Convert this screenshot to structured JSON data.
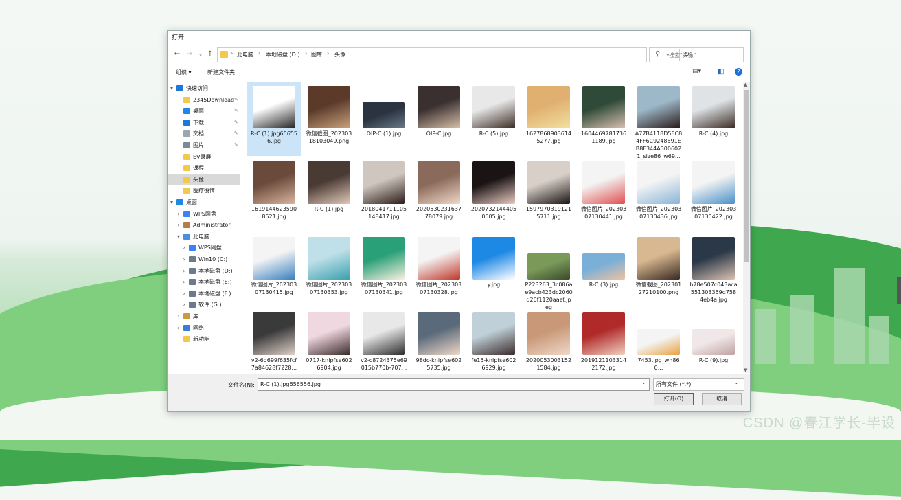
{
  "dialog": {
    "title": "打开",
    "address": {
      "crumbs": [
        "此电脑",
        "本地磁盘 (D:)",
        "图库",
        "头像"
      ],
      "search_placeholder": "搜索\"头像\""
    },
    "toolbar": {
      "organize": "组织 ▾",
      "new_folder": "新建文件夹"
    },
    "nav": [
      {
        "label": "快速访问",
        "level": 0,
        "icon": "star-icon",
        "color": "#1e78d7",
        "arrow": "▾"
      },
      {
        "label": "2345Download",
        "level": 1,
        "icon": "folder-icon",
        "color": "#f3c94b",
        "pin": true
      },
      {
        "label": "桌面",
        "level": 1,
        "icon": "desktop-icon",
        "color": "#1e88e5",
        "pin": true
      },
      {
        "label": "下载",
        "level": 1,
        "icon": "download-icon",
        "color": "#1e78d7",
        "pin": true
      },
      {
        "label": "文档",
        "level": 1,
        "icon": "document-icon",
        "color": "#9aa6b2",
        "pin": true
      },
      {
        "label": "图片",
        "level": 1,
        "icon": "pictures-icon",
        "color": "#7a8a9a",
        "pin": true
      },
      {
        "label": "EV录屏",
        "level": 1,
        "icon": "folder-icon",
        "color": "#f3c94b"
      },
      {
        "label": "课程",
        "level": 1,
        "icon": "folder-icon",
        "color": "#f3c94b"
      },
      {
        "label": "头像",
        "level": 1,
        "icon": "folder-icon",
        "color": "#f3c94b",
        "selected": true
      },
      {
        "label": "医疗役情",
        "level": 1,
        "icon": "folder-icon",
        "color": "#f3c94b"
      },
      {
        "label": "桌面",
        "level": 0,
        "icon": "desktop-icon",
        "color": "#1e88e5",
        "arrow": "▾"
      },
      {
        "label": "WPS网盘",
        "level": 1,
        "icon": "cloud-icon",
        "color": "#3b82f6",
        "arrow": "›"
      },
      {
        "label": "Administrator",
        "level": 1,
        "icon": "user-icon",
        "color": "#b77b4a",
        "arrow": "›"
      },
      {
        "label": "此电脑",
        "level": 1,
        "icon": "computer-icon",
        "color": "#4a90e2",
        "arrow": "▾"
      },
      {
        "label": "WPS网盘",
        "level": 2,
        "icon": "cloud-icon",
        "color": "#3b82f6",
        "arrow": "›"
      },
      {
        "label": "Win10 (C:)",
        "level": 2,
        "icon": "drive-icon",
        "color": "#6b7b8b",
        "arrow": "›"
      },
      {
        "label": "本地磁盘 (D:)",
        "level": 2,
        "icon": "drive-icon",
        "color": "#6b7b8b",
        "arrow": "›"
      },
      {
        "label": "本地磁盘 (E:)",
        "level": 2,
        "icon": "drive-icon",
        "color": "#6b7b8b",
        "arrow": "›"
      },
      {
        "label": "本地磁盘 (F:)",
        "level": 2,
        "icon": "drive-icon",
        "color": "#6b7b8b",
        "arrow": "›"
      },
      {
        "label": "软件 (G:)",
        "level": 2,
        "icon": "drive-icon",
        "color": "#6b7b8b",
        "arrow": "›"
      },
      {
        "label": "库",
        "level": 1,
        "icon": "library-icon",
        "color": "#c89b3c",
        "arrow": "›"
      },
      {
        "label": "网络",
        "level": 1,
        "icon": "network-icon",
        "color": "#3b7dd8",
        "arrow": "›"
      },
      {
        "label": "新功能",
        "level": 1,
        "icon": "folder-icon",
        "color": "#f3c94b"
      }
    ],
    "files": [
      {
        "name": "R-C (1).jpg656556.jpg",
        "thumb": "#ffffff",
        "accent": "#222",
        "selected": true
      },
      {
        "name": "微信截图_20230318103049.png",
        "thumb": "#5b3a2a",
        "accent": "#c9a27b"
      },
      {
        "name": "OIP-C (1).jpg",
        "thumb": "#2b3340",
        "accent": "#6a7a88",
        "wide": true
      },
      {
        "name": "OIP-C.jpg",
        "thumb": "#3a3030",
        "accent": "#d8c0a8"
      },
      {
        "name": "R-C (5).jpg",
        "thumb": "#e8e8e8",
        "accent": "#3a2a22"
      },
      {
        "name": "16278689036145277.jpg",
        "thumb": "#e0b070",
        "accent": "#f3e0a0"
      },
      {
        "name": "16044697817361189.jpg",
        "thumb": "#2f4a38",
        "accent": "#d8c0b0"
      },
      {
        "name": "A77B4118D5EC84FF6C9248591EB8F344A3006021_size86_w69...",
        "thumb": "#9db8c8",
        "accent": "#2a1a18"
      },
      {
        "name": "R-C (4).jpg",
        "thumb": "#dfe3e6",
        "accent": "#3a2a22"
      },
      {
        "name": "16191446235908521.jpg",
        "thumb": "#6a4a3a",
        "accent": "#d9b4a0"
      },
      {
        "name": "R-C (1).jpg",
        "thumb": "#4a3a34",
        "accent": "#e0c8b8"
      },
      {
        "name": "2018041711105148417.jpg",
        "thumb": "#cfc6bf",
        "accent": "#2a1a18"
      },
      {
        "name": "2020530231637 78079.jpg",
        "thumb": "#8a6a5a",
        "accent": "#f0d8c8"
      },
      {
        "name": "20207321444050505.jpg",
        "thumb": "#1a1414",
        "accent": "#e8c8c0"
      },
      {
        "name": "15979703191215711.jpg",
        "thumb": "#d8d0c8",
        "accent": "#1a1414"
      },
      {
        "name": "微信图片_20230307130441.jpg",
        "thumb": "#f4f4f4",
        "accent": "#e05050"
      },
      {
        "name": "微信图片_20230307130436.jpg",
        "thumb": "#f4f4f4",
        "accent": "#8ab4d8"
      },
      {
        "name": "微信图片_20230307130422.jpg",
        "thumb": "#f4f4f4",
        "accent": "#4a90c8"
      },
      {
        "name": "微信图片_20230307130415.jpg",
        "thumb": "#f4f4f4",
        "accent": "#3a80c0"
      },
      {
        "name": "微信图片_20230307130353.jpg",
        "thumb": "#bfe0e8",
        "accent": "#3aa0b0"
      },
      {
        "name": "微信图片_20230307130341.jpg",
        "thumb": "#2aa078",
        "accent": "#f8f0e0"
      },
      {
        "name": "微信图片_20230307130328.jpg",
        "thumb": "#f4f4f4",
        "accent": "#c0392b"
      },
      {
        "name": "y.jpg",
        "thumb": "#1e88e5",
        "accent": "#ffffff"
      },
      {
        "name": "P223263_3c086ae9acb423dc2060d26f1120aaef.jpeg",
        "thumb": "#7a9a5a",
        "accent": "#3a4a2a",
        "wide": true
      },
      {
        "name": "R-C (3).jpg",
        "thumb": "#7ab0d8",
        "accent": "#f0c0a0",
        "wide": true
      },
      {
        "name": "微信截图_20230127210100.png",
        "thumb": "#d8b890",
        "accent": "#3a2a22"
      },
      {
        "name": "b78e507c043aca551303359d7584eb4a.jpg",
        "thumb": "#2a3848",
        "accent": "#d8c0b0"
      },
      {
        "name": "v2-6d699f635fcf7a84628f7228...",
        "thumb": "#3a3a3a",
        "accent": "#e0d0c8"
      },
      {
        "name": "0717-knipfse6026904.jpg",
        "thumb": "#f0d8e0",
        "accent": "#3a2a2a"
      },
      {
        "name": "v2-c8724375e69015b770b-707...",
        "thumb": "#e8e8e8",
        "accent": "#2a2a2a"
      },
      {
        "name": "98dc-knipfse6025735.jpg",
        "thumb": "#5a6a7a",
        "accent": "#f0d8c8"
      },
      {
        "name": "fe15-knipfse6026929.jpg",
        "thumb": "#c0d0d8",
        "accent": "#3a2a2a"
      },
      {
        "name": "20200530031521584.jpg",
        "thumb": "#c89878",
        "accent": "#f0d8c8"
      },
      {
        "name": "20191211033142172.jpg",
        "thumb": "#b02a2a",
        "accent": "#f0d0c0"
      },
      {
        "name": "7453.jpg_wh860...",
        "thumb": "#f4f4f4",
        "accent": "#e8a040",
        "wide": true
      },
      {
        "name": "R-C (9).jpg",
        "thumb": "#f0e8e8",
        "accent": "#c0a0a0",
        "wide": true
      }
    ],
    "footer": {
      "filename_label": "文件名(N):",
      "filename_value": "R-C (1).jpg656556.jpg",
      "filetype_value": "所有文件 (*.*)",
      "open_button": "打开(O)",
      "cancel_button": "取消"
    }
  },
  "watermark": "CSDN @春江学长-毕设"
}
